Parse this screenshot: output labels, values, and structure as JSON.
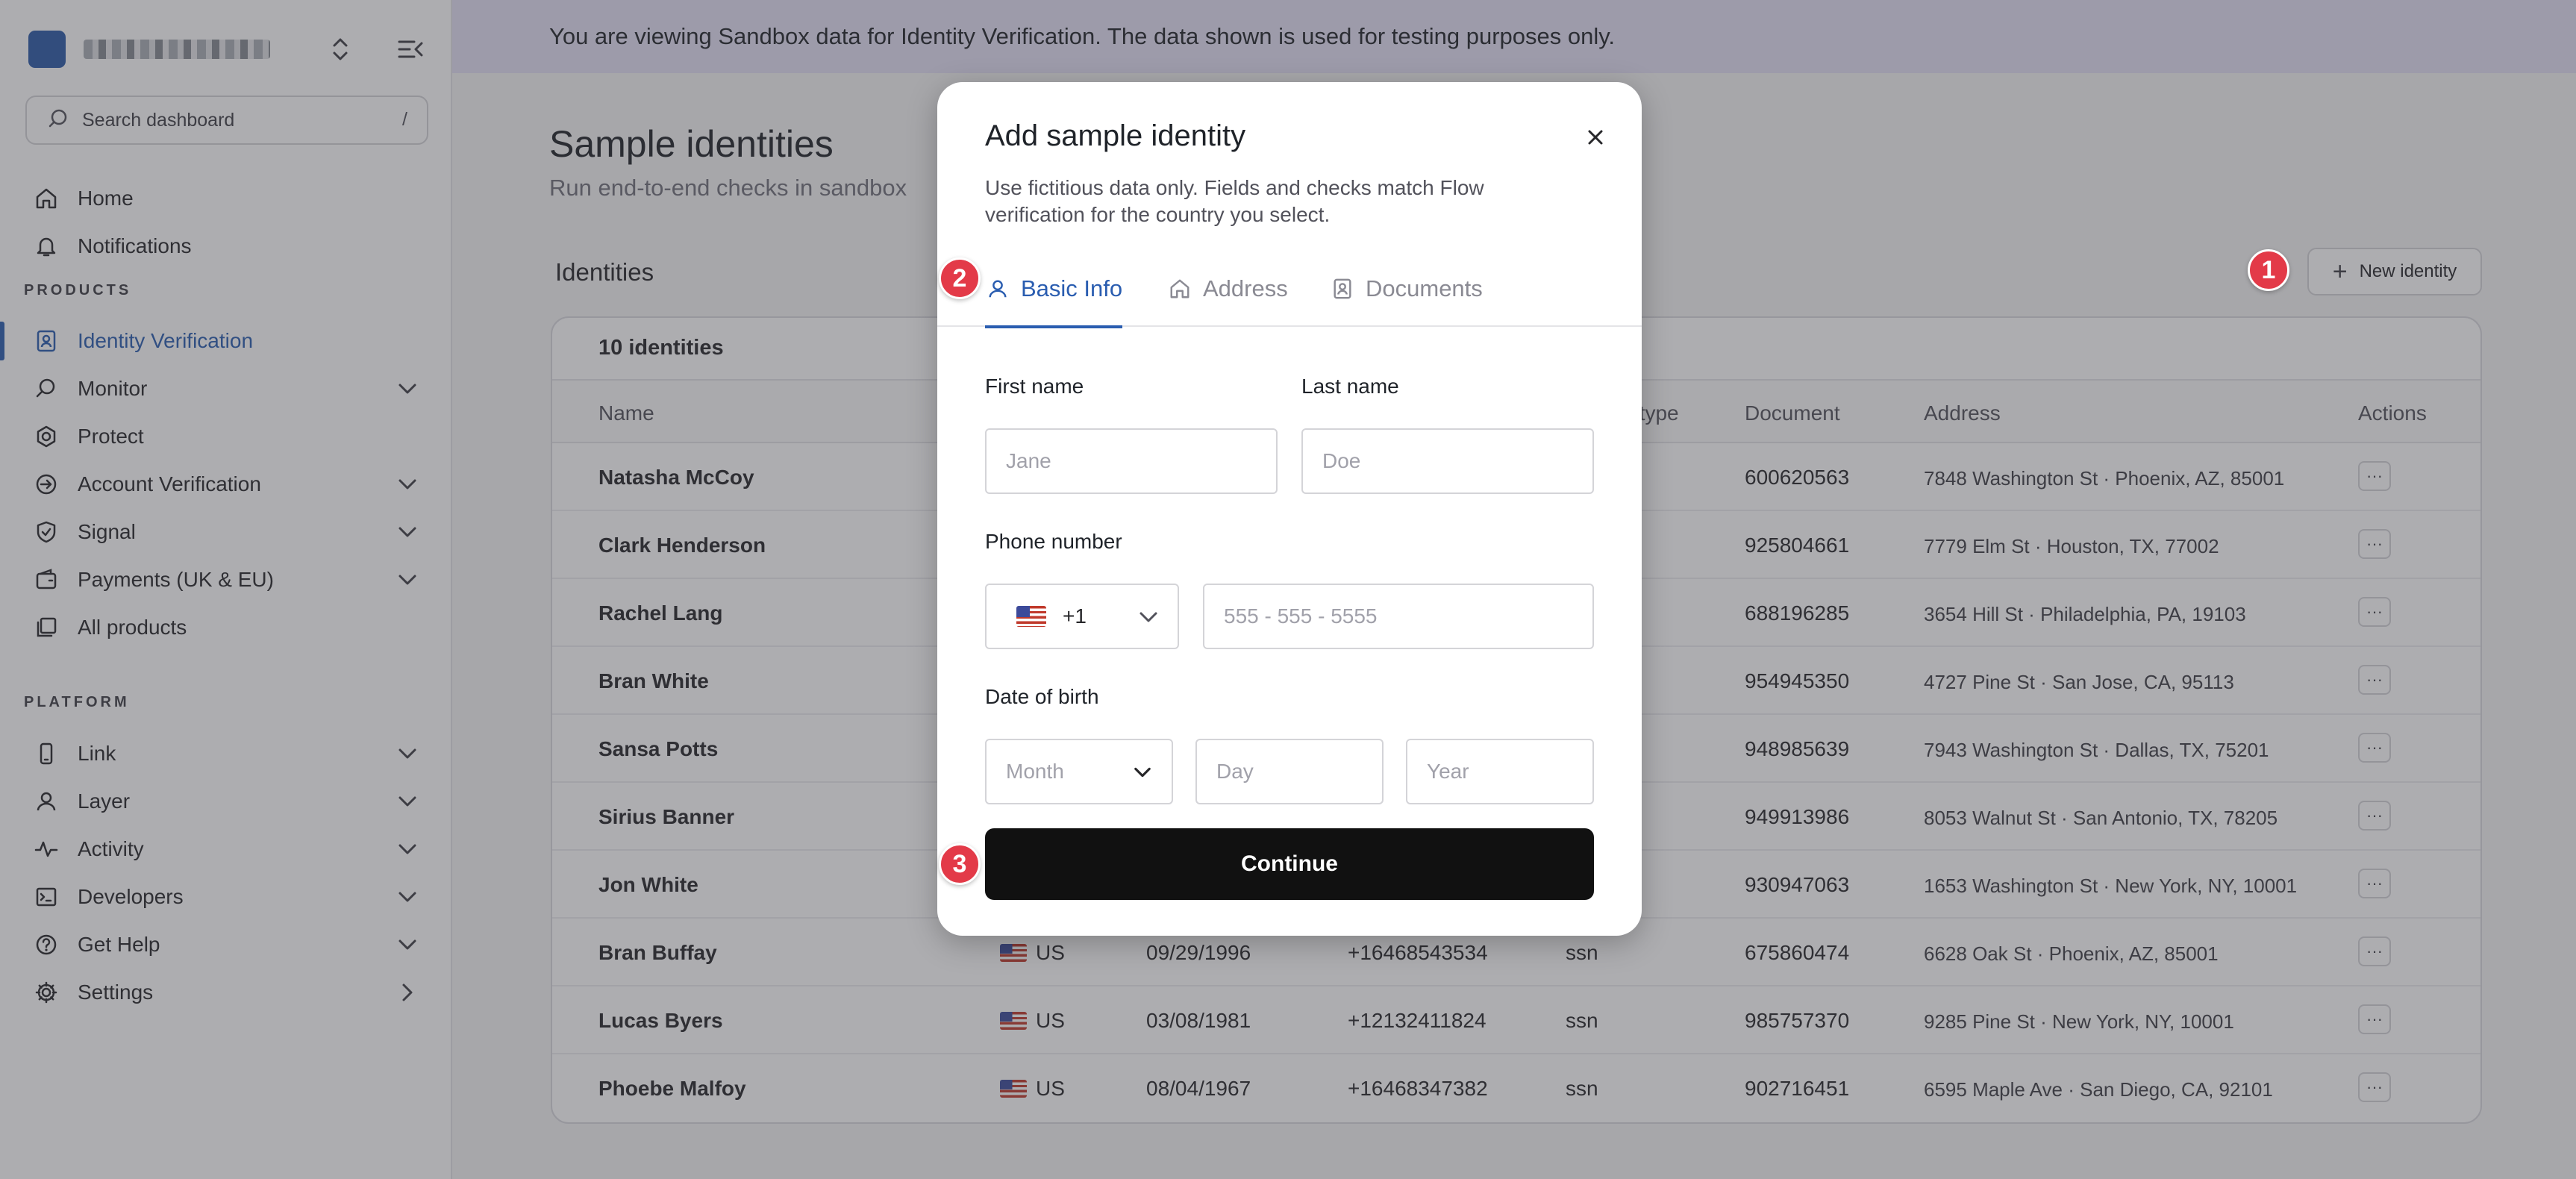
{
  "sidebar": {
    "search_placeholder": "Search dashboard",
    "search_shortcut": "/",
    "nav": [
      {
        "label": "Home",
        "icon": "home-icon"
      },
      {
        "label": "Notifications",
        "icon": "bell-icon"
      }
    ],
    "products_label": "PRODUCTS",
    "products": [
      {
        "label": "Identity Verification",
        "icon": "id-badge-icon",
        "active": true
      },
      {
        "label": "Monitor",
        "icon": "search-icon"
      },
      {
        "label": "Protect",
        "icon": "gear-shield-icon"
      },
      {
        "label": "Account Verification",
        "icon": "arrow-circle-icon"
      },
      {
        "label": "Signal",
        "icon": "shield-check-icon"
      },
      {
        "label": "Payments (UK & EU)",
        "icon": "wallet-icon"
      },
      {
        "label": "All products",
        "icon": "stack-icon"
      }
    ],
    "platform_label": "PLATFORM",
    "platform": [
      {
        "label": "Link",
        "icon": "phone-icon"
      },
      {
        "label": "Layer",
        "icon": "user-icon"
      },
      {
        "label": "Activity",
        "icon": "pulse-icon"
      },
      {
        "label": "Developers",
        "icon": "terminal-icon"
      },
      {
        "label": "Get Help",
        "icon": "help-icon"
      },
      {
        "label": "Settings",
        "icon": "gear-icon"
      }
    ]
  },
  "banner": "You are viewing Sandbox data for Identity Verification. The data shown is used for testing purposes only.",
  "page": {
    "title": "Sample identities",
    "subtitle": "Run end-to-end checks in sandbox",
    "identities_label": "Identities",
    "new_button": "New identity"
  },
  "table": {
    "count": "10 identities",
    "headers": {
      "name": "Name",
      "doc_type": "ent type",
      "document": "Document",
      "address": "Address",
      "actions": "Actions"
    },
    "rows": [
      {
        "name": "Natasha McCoy",
        "country": "",
        "dob": "",
        "phone": "",
        "doc_type": "",
        "document": "600620563",
        "address": "7848 Washington St · Phoenix, AZ, 85001"
      },
      {
        "name": "Clark Henderson",
        "country": "",
        "dob": "",
        "phone": "",
        "doc_type": "",
        "document": "925804661",
        "address": "7779 Elm St · Houston, TX, 77002"
      },
      {
        "name": "Rachel Lang",
        "country": "",
        "dob": "",
        "phone": "",
        "doc_type": "",
        "document": "688196285",
        "address": "3654 Hill St · Philadelphia, PA, 19103"
      },
      {
        "name": "Bran White",
        "country": "",
        "dob": "",
        "phone": "",
        "doc_type": "",
        "document": "954945350",
        "address": "4727 Pine St · San Jose, CA, 95113"
      },
      {
        "name": "Sansa Potts",
        "country": "",
        "dob": "",
        "phone": "",
        "doc_type": "",
        "document": "948985639",
        "address": "7943 Washington St · Dallas, TX, 75201"
      },
      {
        "name": "Sirius Banner",
        "country": "",
        "dob": "",
        "phone": "",
        "doc_type": "",
        "document": "949913986",
        "address": "8053 Walnut St · San Antonio, TX, 78205"
      },
      {
        "name": "Jon White",
        "country": "",
        "dob": "",
        "phone": "",
        "doc_type": "",
        "document": "930947063",
        "address": "1653 Washington St · New York, NY, 10001"
      },
      {
        "name": "Bran Buffay",
        "country": "US",
        "dob": "09/29/1996",
        "phone": "+16468543534",
        "doc_type": "ssn",
        "document": "675860474",
        "address": "6628 Oak St · Phoenix, AZ, 85001"
      },
      {
        "name": "Lucas Byers",
        "country": "US",
        "dob": "03/08/1981",
        "phone": "+12132411824",
        "doc_type": "ssn",
        "document": "985757370",
        "address": "9285 Pine St · New York, NY, 10001"
      },
      {
        "name": "Phoebe Malfoy",
        "country": "US",
        "dob": "08/04/1967",
        "phone": "+16468347382",
        "doc_type": "ssn",
        "document": "902716451",
        "address": "6595 Maple Ave · San Diego, CA, 92101"
      }
    ],
    "actions_glyph": "···"
  },
  "modal": {
    "title": "Add sample identity",
    "description": "Use fictitious data only. Fields and checks match Flow verification for the country you select.",
    "tabs": [
      {
        "label": "Basic Info",
        "icon": "user-icon",
        "active": true
      },
      {
        "label": "Address",
        "icon": "home-icon"
      },
      {
        "label": "Documents",
        "icon": "id-badge-icon"
      }
    ],
    "first_name_label": "First name",
    "first_name_placeholder": "Jane",
    "last_name_label": "Last name",
    "last_name_placeholder": "Doe",
    "phone_label": "Phone number",
    "phone_code": "+1",
    "phone_placeholder": "555 - 555 - 5555",
    "dob_label": "Date of birth",
    "month_placeholder": "Month",
    "day_placeholder": "Day",
    "year_placeholder": "Year",
    "continue_label": "Continue"
  },
  "badges": [
    "1",
    "2",
    "3"
  ],
  "colors": {
    "accent": "#2a5db0",
    "badge": "#e33a48",
    "banner": "#e3e1f4",
    "primary_button": "#111111"
  }
}
